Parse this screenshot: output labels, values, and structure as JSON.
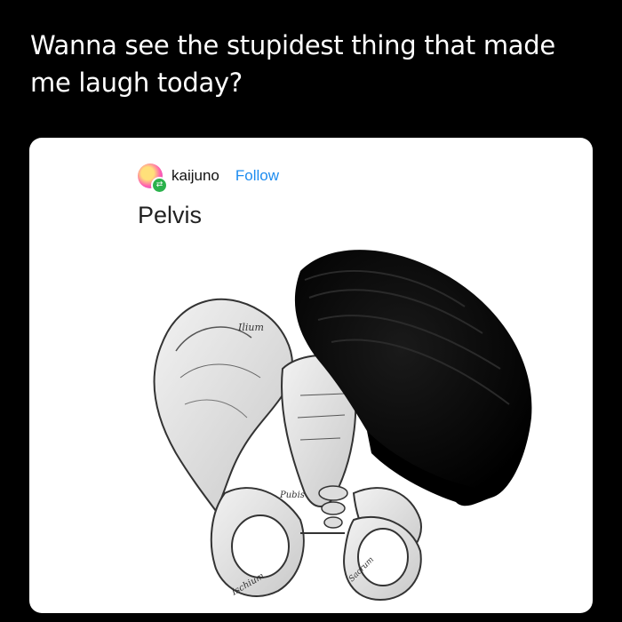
{
  "tweet": {
    "text": "Wanna see the stupidest thing that made me laugh today?"
  },
  "post": {
    "username": "kaijuno",
    "follow_label": "Follow",
    "title": "Pelvis"
  },
  "illustration": {
    "label_ilium": "Ilium",
    "label_pubis": "Pubis",
    "label_ischium": "Ischium",
    "label_sacrum": "Sacrum"
  },
  "icons": {
    "avatar": "avatar-icon",
    "reblog": "reblog-icon"
  },
  "colors": {
    "background": "#000000",
    "card": "#ffffff",
    "follow": "#1d8cf0",
    "reblog_badge": "#2bb24c"
  }
}
